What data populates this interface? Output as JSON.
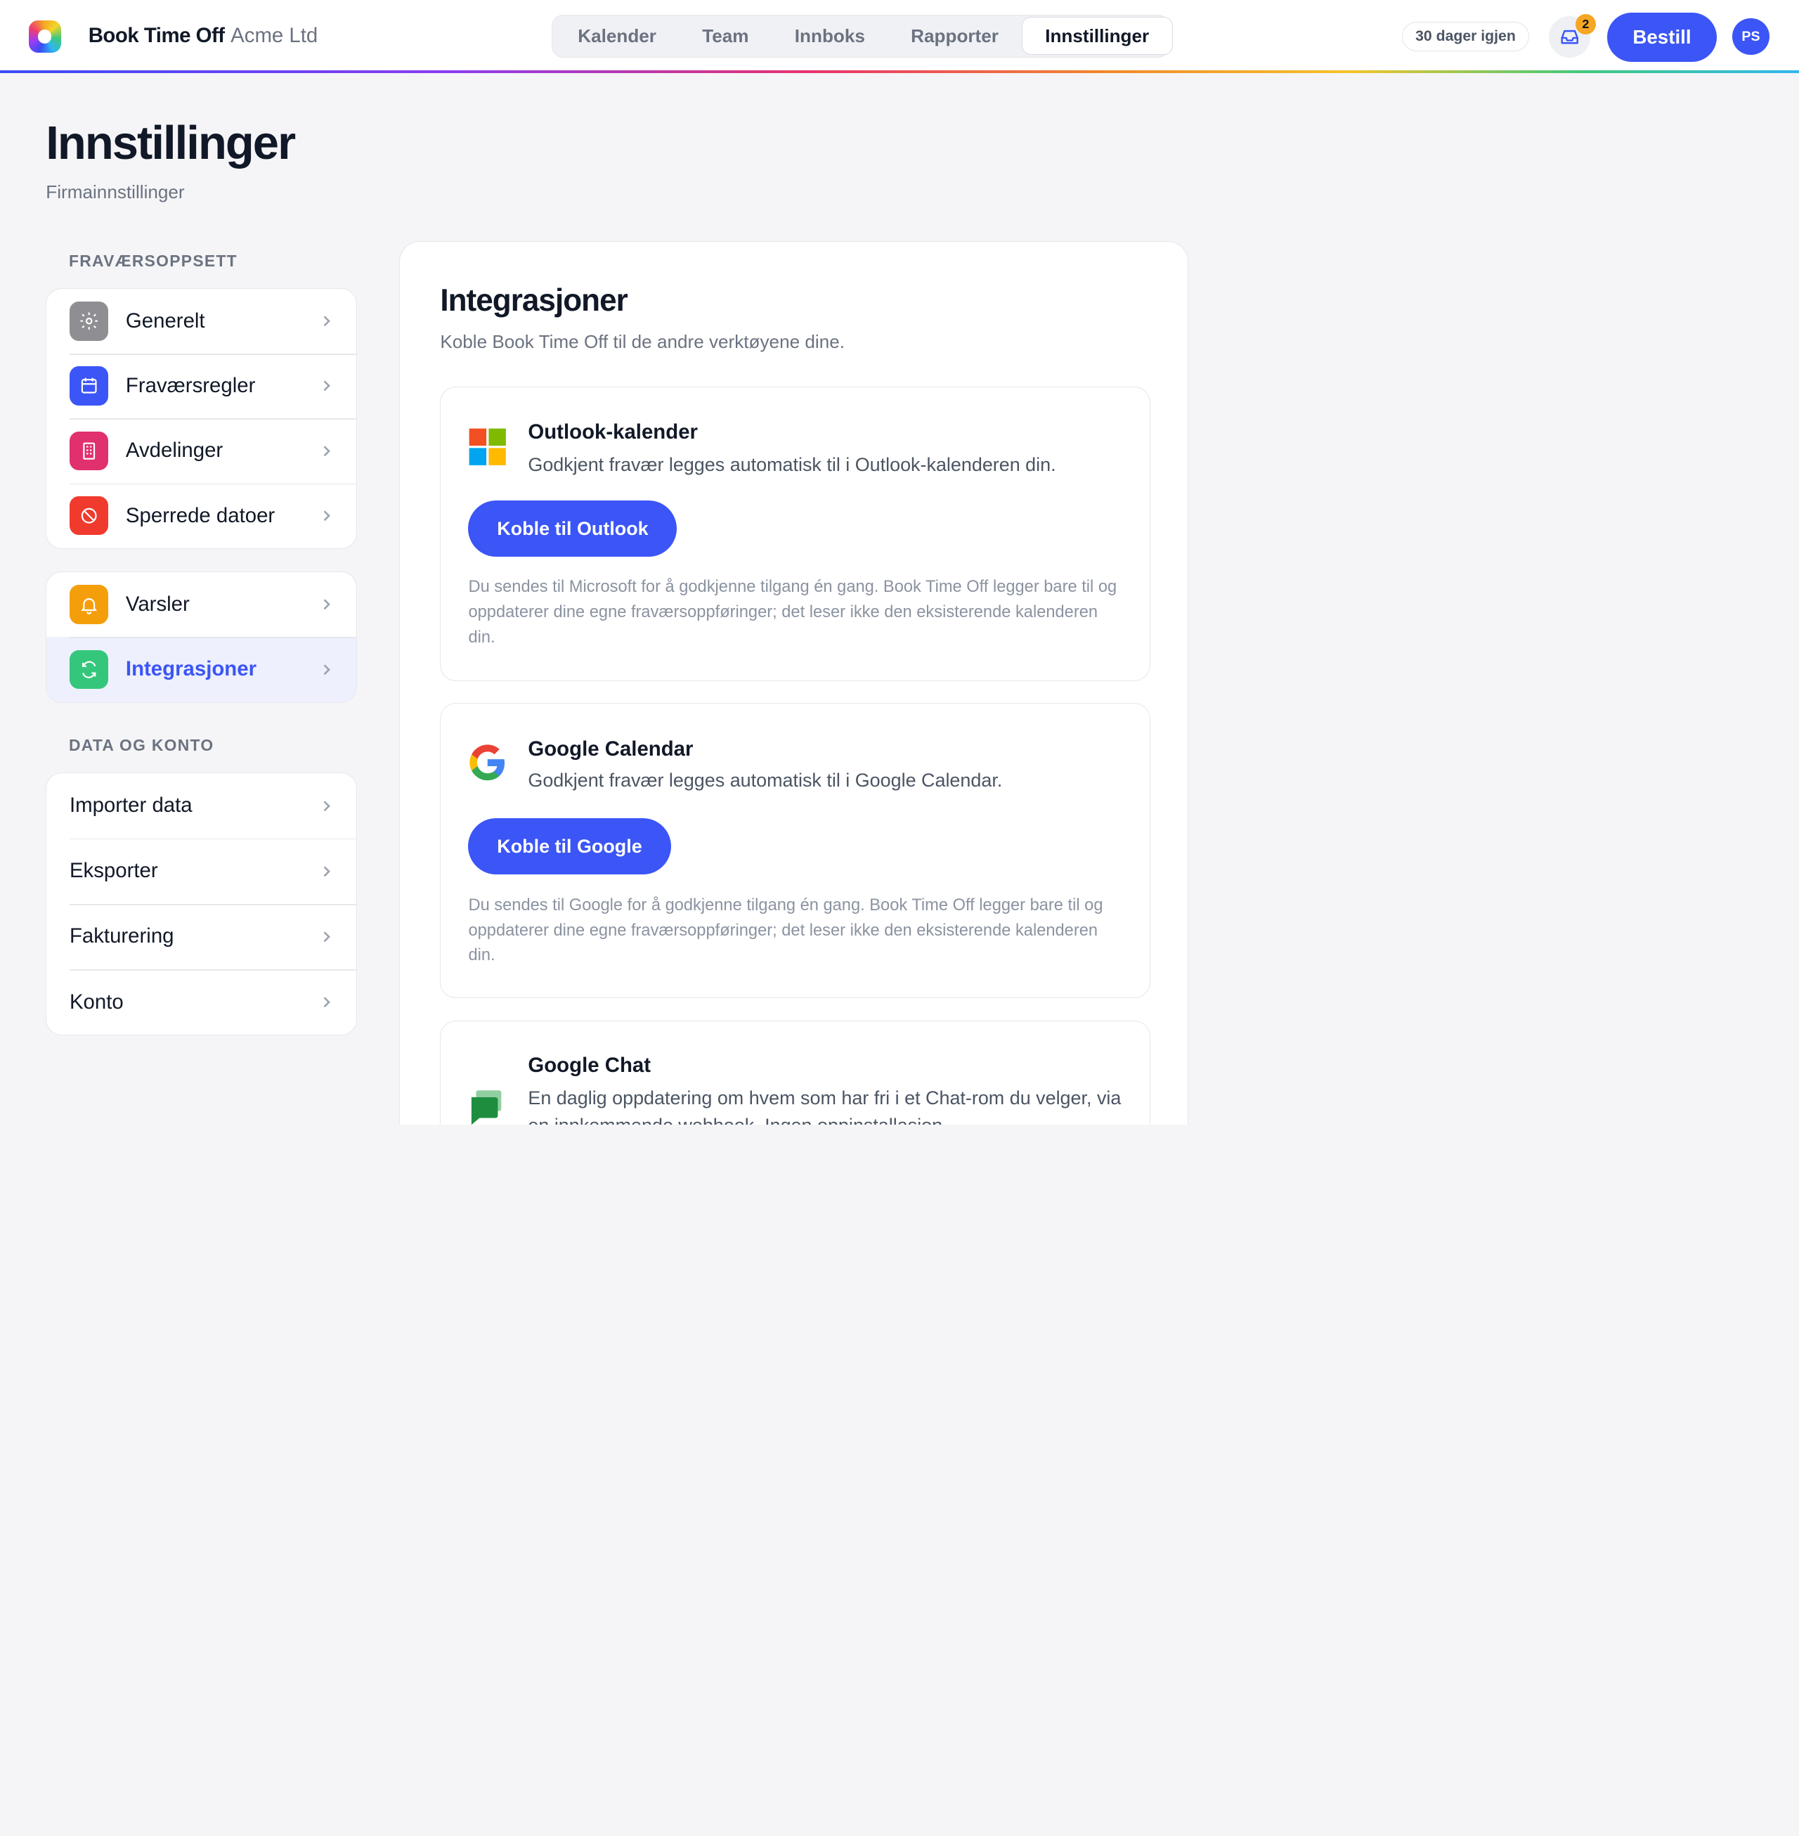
{
  "app": {
    "brand": "Book Time Off",
    "company": "Acme Ltd"
  },
  "nav": {
    "tabs": [
      "Kalender",
      "Team",
      "Innboks",
      "Rapporter",
      "Innstillinger"
    ],
    "active": "Innstillinger"
  },
  "header": {
    "trial": "30 dager igjen",
    "inbox_count": "2",
    "order_label": "Bestill",
    "avatar_initials": "PS"
  },
  "page": {
    "title": "Innstillinger",
    "subtitle": "Firmainnstillinger"
  },
  "sidebar": {
    "section1_label": "FRAVÆRSOPPSETT",
    "group1": [
      {
        "label": "Generelt",
        "icon": "gear-icon",
        "color": "#8e8e93"
      },
      {
        "label": "Fraværsregler",
        "icon": "calendar-icon",
        "color": "#3b55f6"
      },
      {
        "label": "Avdelinger",
        "icon": "building-icon",
        "color": "#e0306d"
      },
      {
        "label": "Sperrede datoer",
        "icon": "blocked-icon",
        "color": "#f03a2e"
      }
    ],
    "group2": [
      {
        "label": "Varsler",
        "icon": "bell-icon",
        "color": "#f59e0b"
      },
      {
        "label": "Integrasjoner",
        "icon": "sync-icon",
        "color": "#34c77b",
        "active": true
      }
    ],
    "section2_label": "DATA OG KONTO",
    "group3": [
      {
        "label": "Importer data"
      },
      {
        "label": "Eksporter"
      },
      {
        "label": "Fakturering"
      },
      {
        "label": "Konto"
      }
    ]
  },
  "main": {
    "title": "Integrasjoner",
    "description": "Koble Book Time Off til de andre verktøyene dine.",
    "integrations": [
      {
        "name": "Outlook-kalender",
        "icon": "microsoft-logo-icon",
        "description": "Godkjent fravær legges automatisk til i Outlook-kalenderen din.",
        "button": "Koble til Outlook",
        "note": "Du sendes til Microsoft for å godkjenne tilgang én gang. Book Time Off legger bare til og oppdaterer dine egne fraværsoppføringer; det leser ikke den eksisterende kalenderen din."
      },
      {
        "name": "Google Calendar",
        "icon": "google-logo-icon",
        "description": "Godkjent fravær legges automatisk til i Google Calendar.",
        "button": "Koble til Google",
        "note": "Du sendes til Google for å godkjenne tilgang én gang. Book Time Off legger bare til og oppdaterer dine egne fraværsoppføringer; det leser ikke den eksisterende kalenderen din."
      },
      {
        "name": "Google Chat",
        "icon": "google-chat-icon",
        "description": "En daglig oppdatering om hvem som har fri i et Chat-rom du velger, via en innkommende webhook. Ingen oppinstallasjon"
      }
    ]
  }
}
